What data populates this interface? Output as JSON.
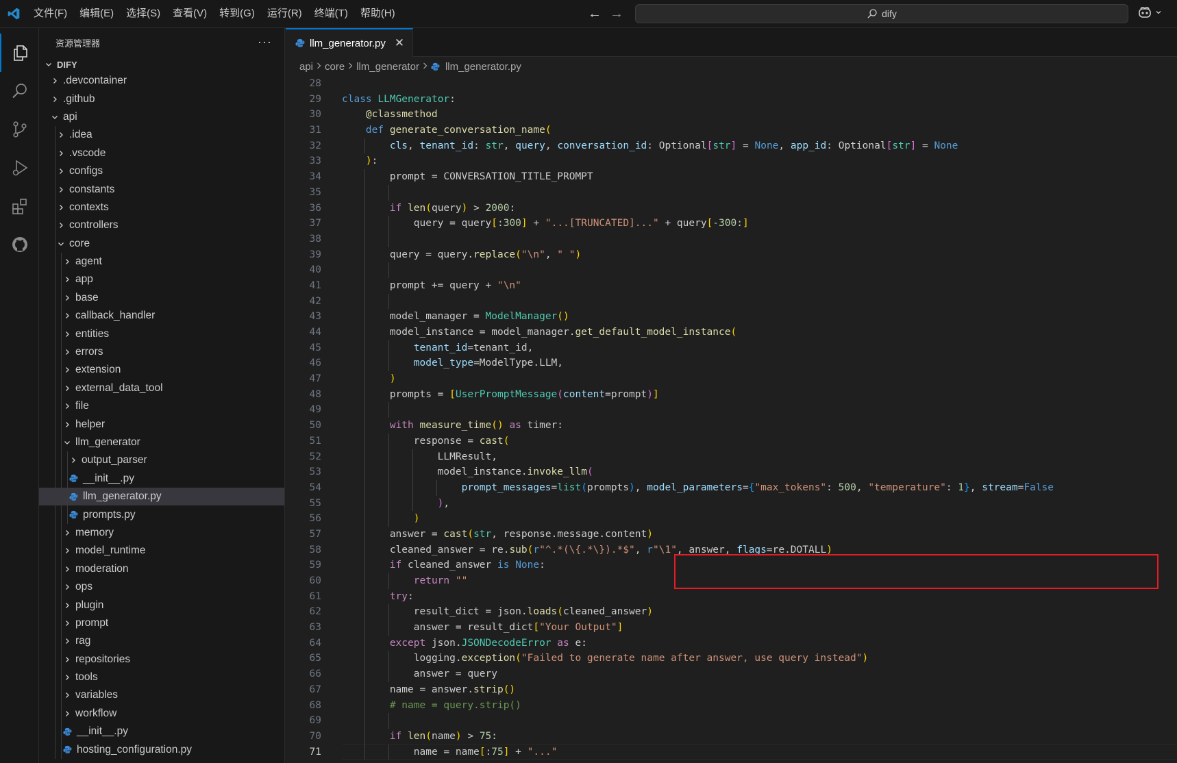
{
  "titlebar": {
    "menu": [
      "文件(F)",
      "编辑(E)",
      "选择(S)",
      "查看(V)",
      "转到(G)",
      "运行(R)",
      "终端(T)",
      "帮助(H)"
    ],
    "search_text": "dify"
  },
  "activity": [
    "explorer-icon",
    "search-icon",
    "source-control-icon",
    "run-debug-icon",
    "extensions-icon",
    "github-icon"
  ],
  "sidebar": {
    "title": "资源管理器",
    "more": "···",
    "tree": [
      {
        "label": "DIFY",
        "depth": 0,
        "kind": "folder-open",
        "root": true
      },
      {
        "label": ".devcontainer",
        "depth": 1,
        "kind": "folder"
      },
      {
        "label": ".github",
        "depth": 1,
        "kind": "folder"
      },
      {
        "label": "api",
        "depth": 1,
        "kind": "folder-open"
      },
      {
        "label": ".idea",
        "depth": 2,
        "kind": "folder"
      },
      {
        "label": ".vscode",
        "depth": 2,
        "kind": "folder"
      },
      {
        "label": "configs",
        "depth": 2,
        "kind": "folder"
      },
      {
        "label": "constants",
        "depth": 2,
        "kind": "folder"
      },
      {
        "label": "contexts",
        "depth": 2,
        "kind": "folder"
      },
      {
        "label": "controllers",
        "depth": 2,
        "kind": "folder"
      },
      {
        "label": "core",
        "depth": 2,
        "kind": "folder-open"
      },
      {
        "label": "agent",
        "depth": 3,
        "kind": "folder"
      },
      {
        "label": "app",
        "depth": 3,
        "kind": "folder"
      },
      {
        "label": "base",
        "depth": 3,
        "kind": "folder"
      },
      {
        "label": "callback_handler",
        "depth": 3,
        "kind": "folder"
      },
      {
        "label": "entities",
        "depth": 3,
        "kind": "folder"
      },
      {
        "label": "errors",
        "depth": 3,
        "kind": "folder"
      },
      {
        "label": "extension",
        "depth": 3,
        "kind": "folder"
      },
      {
        "label": "external_data_tool",
        "depth": 3,
        "kind": "folder"
      },
      {
        "label": "file",
        "depth": 3,
        "kind": "folder"
      },
      {
        "label": "helper",
        "depth": 3,
        "kind": "folder"
      },
      {
        "label": "llm_generator",
        "depth": 3,
        "kind": "folder-open"
      },
      {
        "label": "output_parser",
        "depth": 4,
        "kind": "folder"
      },
      {
        "label": "__init__.py",
        "depth": 4,
        "kind": "py"
      },
      {
        "label": "llm_generator.py",
        "depth": 4,
        "kind": "py",
        "selected": true
      },
      {
        "label": "prompts.py",
        "depth": 4,
        "kind": "py"
      },
      {
        "label": "memory",
        "depth": 3,
        "kind": "folder"
      },
      {
        "label": "model_runtime",
        "depth": 3,
        "kind": "folder"
      },
      {
        "label": "moderation",
        "depth": 3,
        "kind": "folder"
      },
      {
        "label": "ops",
        "depth": 3,
        "kind": "folder"
      },
      {
        "label": "plugin",
        "depth": 3,
        "kind": "folder"
      },
      {
        "label": "prompt",
        "depth": 3,
        "kind": "folder"
      },
      {
        "label": "rag",
        "depth": 3,
        "kind": "folder"
      },
      {
        "label": "repositories",
        "depth": 3,
        "kind": "folder"
      },
      {
        "label": "tools",
        "depth": 3,
        "kind": "folder"
      },
      {
        "label": "variables",
        "depth": 3,
        "kind": "folder"
      },
      {
        "label": "workflow",
        "depth": 3,
        "kind": "folder"
      },
      {
        "label": "__init__.py",
        "depth": 3,
        "kind": "py"
      },
      {
        "label": "hosting_configuration.py",
        "depth": 3,
        "kind": "py"
      }
    ]
  },
  "editor": {
    "tab_label": "llm_generator.py",
    "tab_close": "✕",
    "breadcrumb": [
      "api",
      "core",
      "llm_generator",
      "llm_generator.py"
    ],
    "current_line": 71,
    "lines": [
      {
        "n": 28,
        "i": 0,
        "t": [
          [
            "",
            "w"
          ]
        ]
      },
      {
        "n": 29,
        "i": 0,
        "t": [
          [
            "class ",
            "k"
          ],
          [
            "LLMGenerator",
            "t"
          ],
          [
            ":",
            "w"
          ]
        ]
      },
      {
        "n": 30,
        "i": 1,
        "t": [
          [
            "@classmethod",
            "f"
          ]
        ]
      },
      {
        "n": 31,
        "i": 1,
        "t": [
          [
            "def ",
            "k"
          ],
          [
            "generate_conversation_name",
            "f"
          ],
          [
            "(",
            "br1"
          ]
        ]
      },
      {
        "n": 32,
        "i": 2,
        "t": [
          [
            "cls",
            "v"
          ],
          [
            ", ",
            "w"
          ],
          [
            "tenant_id",
            "v"
          ],
          [
            ": ",
            "w"
          ],
          [
            "str",
            "t"
          ],
          [
            ", ",
            "w"
          ],
          [
            "query",
            "v"
          ],
          [
            ", ",
            "w"
          ],
          [
            "conversation_id",
            "v"
          ],
          [
            ": Optional",
            "w"
          ],
          [
            "[",
            "br2"
          ],
          [
            "str",
            "t"
          ],
          [
            "]",
            "br2"
          ],
          [
            " = ",
            "w"
          ],
          [
            "None",
            "k"
          ],
          [
            ", ",
            "w"
          ],
          [
            "app_id",
            "v"
          ],
          [
            ": Optional",
            "w"
          ],
          [
            "[",
            "br2"
          ],
          [
            "str",
            "t"
          ],
          [
            "]",
            "br2"
          ],
          [
            " = ",
            "w"
          ],
          [
            "None",
            "k"
          ]
        ]
      },
      {
        "n": 33,
        "i": 1,
        "t": [
          [
            ")",
            "br1"
          ],
          [
            ":",
            "w"
          ]
        ]
      },
      {
        "n": 34,
        "i": 2,
        "t": [
          [
            "prompt = CONVERSATION_TITLE_PROMPT",
            "w"
          ]
        ]
      },
      {
        "n": 35,
        "i": 0,
        "t": [
          [
            "",
            "w"
          ]
        ]
      },
      {
        "n": 36,
        "i": 2,
        "t": [
          [
            "if ",
            "kc"
          ],
          [
            "len",
            "f"
          ],
          [
            "(",
            "br1"
          ],
          [
            "query",
            "w"
          ],
          [
            ")",
            "br1"
          ],
          [
            " > ",
            "w"
          ],
          [
            "2000",
            "n"
          ],
          [
            ":",
            "w"
          ]
        ]
      },
      {
        "n": 37,
        "i": 3,
        "t": [
          [
            "query = query",
            "w"
          ],
          [
            "[",
            "br1"
          ],
          [
            ":",
            "w"
          ],
          [
            "300",
            "n"
          ],
          [
            "]",
            "br1"
          ],
          [
            " + ",
            "w"
          ],
          [
            "\"...[TRUNCATED]...\"",
            "s"
          ],
          [
            " + query",
            "w"
          ],
          [
            "[",
            "br1"
          ],
          [
            "-300",
            "n"
          ],
          [
            ":",
            "w"
          ],
          [
            "]",
            "br1"
          ]
        ]
      },
      {
        "n": 38,
        "i": 0,
        "t": [
          [
            "",
            "w"
          ]
        ]
      },
      {
        "n": 39,
        "i": 2,
        "t": [
          [
            "query = query.",
            "w"
          ],
          [
            "replace",
            "f"
          ],
          [
            "(",
            "br1"
          ],
          [
            "\"\\n\"",
            "s"
          ],
          [
            ", ",
            "w"
          ],
          [
            "\" \"",
            "s"
          ],
          [
            ")",
            "br1"
          ]
        ]
      },
      {
        "n": 40,
        "i": 0,
        "t": [
          [
            "",
            "w"
          ]
        ]
      },
      {
        "n": 41,
        "i": 2,
        "t": [
          [
            "prompt += query + ",
            "w"
          ],
          [
            "\"\\n\"",
            "s"
          ]
        ]
      },
      {
        "n": 42,
        "i": 0,
        "t": [
          [
            "",
            "w"
          ]
        ]
      },
      {
        "n": 43,
        "i": 2,
        "t": [
          [
            "model_manager = ",
            "w"
          ],
          [
            "ModelManager",
            "t"
          ],
          [
            "()",
            "br1"
          ]
        ]
      },
      {
        "n": 44,
        "i": 2,
        "t": [
          [
            "model_instance = model_manager.",
            "w"
          ],
          [
            "get_default_model_instance",
            "f"
          ],
          [
            "(",
            "br1"
          ]
        ]
      },
      {
        "n": 45,
        "i": 3,
        "t": [
          [
            "tenant_id",
            "v"
          ],
          [
            "=tenant_id,",
            "w"
          ]
        ]
      },
      {
        "n": 46,
        "i": 3,
        "t": [
          [
            "model_type",
            "v"
          ],
          [
            "=ModelType.LLM,",
            "w"
          ]
        ]
      },
      {
        "n": 47,
        "i": 2,
        "t": [
          [
            ")",
            "br1"
          ]
        ]
      },
      {
        "n": 48,
        "i": 2,
        "t": [
          [
            "prompts = ",
            "w"
          ],
          [
            "[",
            "br1"
          ],
          [
            "UserPromptMessage",
            "t"
          ],
          [
            "(",
            "br2"
          ],
          [
            "content",
            "v"
          ],
          [
            "=prompt",
            "w"
          ],
          [
            ")",
            "br2"
          ],
          [
            "]",
            "br1"
          ]
        ]
      },
      {
        "n": 49,
        "i": 0,
        "t": [
          [
            "",
            "w"
          ]
        ]
      },
      {
        "n": 50,
        "i": 2,
        "t": [
          [
            "with ",
            "kc"
          ],
          [
            "measure_time",
            "f"
          ],
          [
            "()",
            "br1"
          ],
          [
            " as ",
            "kc"
          ],
          [
            "timer:",
            "w"
          ]
        ]
      },
      {
        "n": 51,
        "i": 3,
        "t": [
          [
            "response = ",
            "w"
          ],
          [
            "cast",
            "f"
          ],
          [
            "(",
            "br1"
          ]
        ]
      },
      {
        "n": 52,
        "i": 4,
        "t": [
          [
            "LLMResult,",
            "w"
          ]
        ]
      },
      {
        "n": 53,
        "i": 4,
        "t": [
          [
            "model_instance.",
            "w"
          ],
          [
            "invoke_llm",
            "f"
          ],
          [
            "(",
            "br2"
          ]
        ]
      },
      {
        "n": 54,
        "i": 5,
        "t": [
          [
            "prompt_messages",
            "v"
          ],
          [
            "=",
            "w"
          ],
          [
            "list",
            "t"
          ],
          [
            "(",
            "br3"
          ],
          [
            "prompts",
            "w"
          ],
          [
            ")",
            "br3"
          ],
          [
            ", ",
            "w"
          ],
          [
            "model_parameters",
            "v"
          ],
          [
            "=",
            "w"
          ],
          [
            "{",
            "br3"
          ],
          [
            "\"max_tokens\"",
            "s"
          ],
          [
            ": ",
            "w"
          ],
          [
            "500",
            "n"
          ],
          [
            ", ",
            "w"
          ],
          [
            "\"temperature\"",
            "s"
          ],
          [
            ": ",
            "w"
          ],
          [
            "1",
            "n"
          ],
          [
            "}",
            "br3"
          ],
          [
            ", ",
            "w"
          ],
          [
            "stream",
            "v"
          ],
          [
            "=",
            "w"
          ],
          [
            "False",
            "k"
          ]
        ]
      },
      {
        "n": 55,
        "i": 4,
        "t": [
          [
            ")",
            "br2"
          ],
          [
            ",",
            "w"
          ]
        ]
      },
      {
        "n": 56,
        "i": 3,
        "t": [
          [
            ")",
            "br1"
          ]
        ]
      },
      {
        "n": 57,
        "i": 2,
        "t": [
          [
            "answer = ",
            "w"
          ],
          [
            "cast",
            "f"
          ],
          [
            "(",
            "br1"
          ],
          [
            "str",
            "t"
          ],
          [
            ", response.message.content",
            "w"
          ],
          [
            ")",
            "br1"
          ]
        ]
      },
      {
        "n": 58,
        "i": 2,
        "t": [
          [
            "cleaned_answer = re.",
            "w"
          ],
          [
            "sub",
            "f"
          ],
          [
            "(",
            "br1"
          ],
          [
            "r",
            "k"
          ],
          [
            "\"^.*(\\{.*\\}).*$\"",
            "s"
          ],
          [
            ", ",
            "w"
          ],
          [
            "r",
            "k"
          ],
          [
            "\"\\1\"",
            "s"
          ],
          [
            ", answer, ",
            "w"
          ],
          [
            "flags",
            "v"
          ],
          [
            "=re.DOTALL",
            "w"
          ],
          [
            ")",
            "br1"
          ]
        ]
      },
      {
        "n": 59,
        "i": 2,
        "t": [
          [
            "if ",
            "kc"
          ],
          [
            "cleaned_answer ",
            "w"
          ],
          [
            "is ",
            "k"
          ],
          [
            "None",
            "k"
          ],
          [
            ":",
            "w"
          ]
        ]
      },
      {
        "n": 60,
        "i": 3,
        "t": [
          [
            "return ",
            "kc"
          ],
          [
            "\"\"",
            "s"
          ]
        ]
      },
      {
        "n": 61,
        "i": 2,
        "t": [
          [
            "try",
            "kc"
          ],
          [
            ":",
            "w"
          ]
        ]
      },
      {
        "n": 62,
        "i": 3,
        "t": [
          [
            "result_dict = json.",
            "w"
          ],
          [
            "loads",
            "f"
          ],
          [
            "(",
            "br1"
          ],
          [
            "cleaned_answer",
            "w"
          ],
          [
            ")",
            "br1"
          ]
        ]
      },
      {
        "n": 63,
        "i": 3,
        "t": [
          [
            "answer = result_dict",
            "w"
          ],
          [
            "[",
            "br1"
          ],
          [
            "\"Your Output\"",
            "s"
          ],
          [
            "]",
            "br1"
          ]
        ]
      },
      {
        "n": 64,
        "i": 2,
        "t": [
          [
            "except ",
            "kc"
          ],
          [
            "json.",
            "w"
          ],
          [
            "JSONDecodeError",
            "t"
          ],
          [
            " as ",
            "kc"
          ],
          [
            "e:",
            "w"
          ]
        ]
      },
      {
        "n": 65,
        "i": 3,
        "t": [
          [
            "logging.",
            "w"
          ],
          [
            "exception",
            "f"
          ],
          [
            "(",
            "br1"
          ],
          [
            "\"Failed to generate name after answer, use query instead\"",
            "s"
          ],
          [
            ")",
            "br1"
          ]
        ]
      },
      {
        "n": 66,
        "i": 3,
        "t": [
          [
            "answer = query",
            "w"
          ]
        ]
      },
      {
        "n": 67,
        "i": 2,
        "t": [
          [
            "name = answer.",
            "w"
          ],
          [
            "strip",
            "f"
          ],
          [
            "()",
            "br1"
          ]
        ]
      },
      {
        "n": 68,
        "i": 2,
        "t": [
          [
            "# name = query.strip()",
            "c"
          ]
        ]
      },
      {
        "n": 69,
        "i": 0,
        "t": [
          [
            "",
            "w"
          ]
        ]
      },
      {
        "n": 70,
        "i": 2,
        "t": [
          [
            "if ",
            "kc"
          ],
          [
            "len",
            "f"
          ],
          [
            "(",
            "br1"
          ],
          [
            "name",
            "w"
          ],
          [
            ")",
            "br1"
          ],
          [
            " > ",
            "w"
          ],
          [
            "75",
            "n"
          ],
          [
            ":",
            "w"
          ]
        ]
      },
      {
        "n": 71,
        "i": 3,
        "t": [
          [
            "name = name",
            "w"
          ],
          [
            "[",
            "br1"
          ],
          [
            ":",
            "w"
          ],
          [
            "75",
            "n"
          ],
          [
            "]",
            "br1"
          ],
          [
            " + ",
            "w"
          ],
          [
            "\"...\"",
            "s"
          ]
        ]
      }
    ]
  },
  "colors": {
    "accent": "#0078d4",
    "highlight_box": "#e51c23",
    "python_icon": "#3b8ede"
  }
}
